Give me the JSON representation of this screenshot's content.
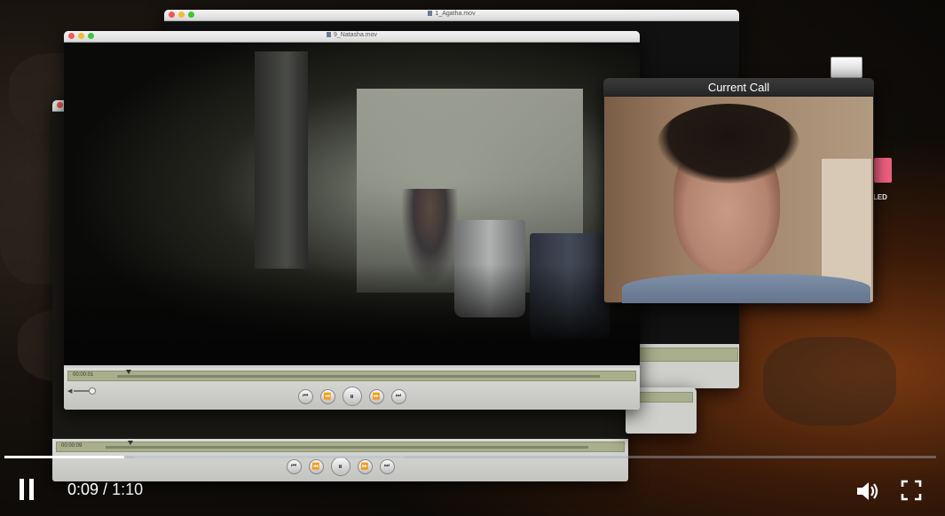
{
  "windows": [
    {
      "id": "agatha",
      "title": "1_Agatha.mov"
    },
    {
      "id": "natasha",
      "title": "9_Natasha.mov"
    }
  ],
  "natasha_timecode": "00:00:01",
  "lower_timecode": "00:00:09",
  "call": {
    "title": "Current Call"
  },
  "desktop": {
    "label": "TLED"
  },
  "player": {
    "current_time": "0:09",
    "separator": " / ",
    "duration": "1:10",
    "progress_fraction": 0.1286
  },
  "icons": {
    "pause": "pause-icon",
    "volume": "volume-icon",
    "fullscreen": "fullscreen-icon"
  }
}
